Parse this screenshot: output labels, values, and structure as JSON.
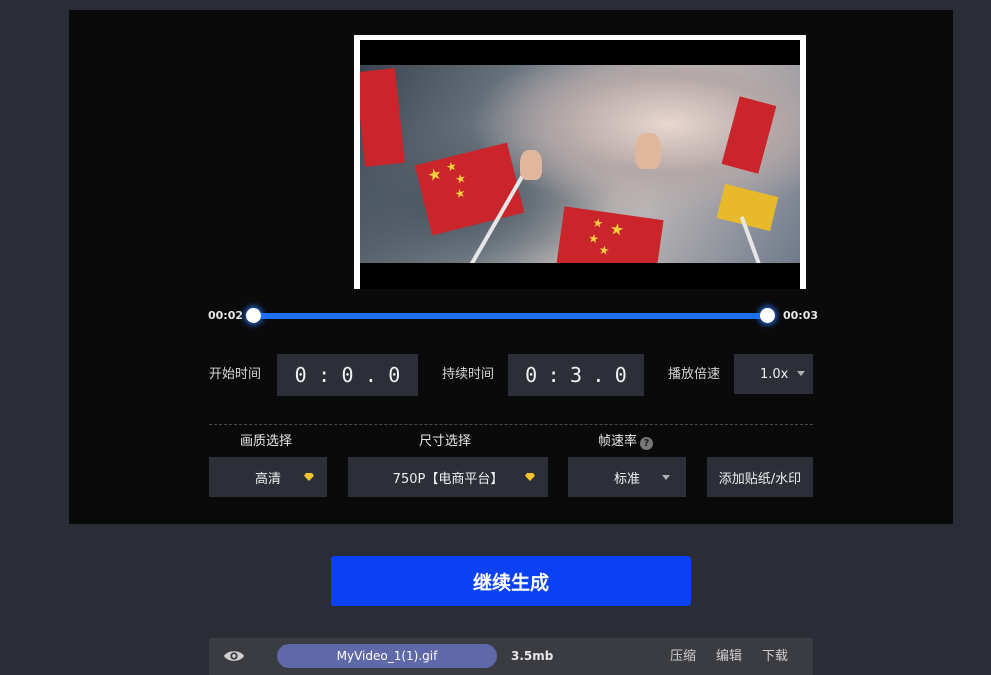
{
  "player": {
    "start_time_label": "00:02",
    "end_time_label": "00:03"
  },
  "controls": {
    "start_time": {
      "label": "开始时间",
      "digits": [
        "0",
        ":",
        "0",
        ".",
        "0"
      ]
    },
    "duration": {
      "label": "持续时间",
      "digits": [
        "0",
        ":",
        "3",
        ".",
        "0"
      ]
    },
    "speed": {
      "label": "播放倍速",
      "value": "1.0x"
    }
  },
  "options": {
    "quality": {
      "header": "画质选择",
      "value": "高清",
      "premium_icon": "diamond-icon"
    },
    "size": {
      "header": "尺寸选择",
      "value": "750P【电商平台】",
      "premium_icon": "diamond-icon"
    },
    "fps": {
      "header": "帧速率",
      "help": "?",
      "value": "标准"
    },
    "sticker_button": "添加贴纸/水印"
  },
  "generate_button": "继续生成",
  "file": {
    "name": "MyVideo_1(1).gif",
    "size": "3.5mb",
    "actions": {
      "compress": "压缩",
      "edit": "编辑",
      "download": "下载"
    }
  },
  "colors": {
    "accent": "#0a41f5",
    "slider": "#1e6ef0",
    "file_pill": "#5f68a8",
    "premium": "#f2c230"
  }
}
